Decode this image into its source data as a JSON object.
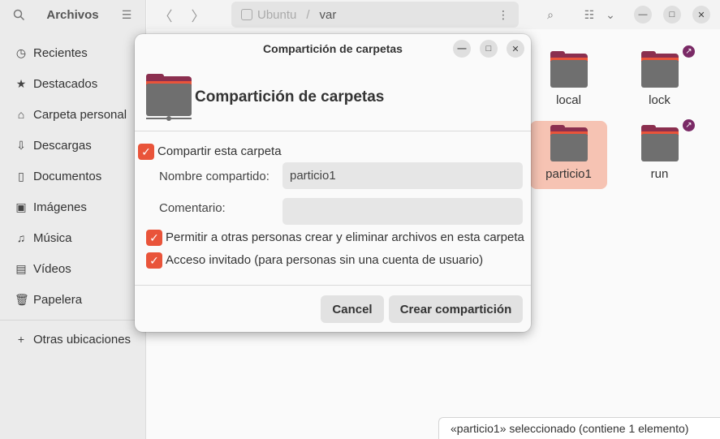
{
  "sidebar": {
    "title": "Archivos",
    "items": [
      {
        "label": "Recientes",
        "icon": "clock-icon"
      },
      {
        "label": "Destacados",
        "icon": "star-icon"
      },
      {
        "label": "Carpeta personal",
        "icon": "home-icon"
      },
      {
        "label": "Descargas",
        "icon": "download-icon"
      },
      {
        "label": "Documentos",
        "icon": "document-icon"
      },
      {
        "label": "Imágenes",
        "icon": "image-icon"
      },
      {
        "label": "Música",
        "icon": "music-icon"
      },
      {
        "label": "Vídeos",
        "icon": "video-icon"
      },
      {
        "label": "Papelera",
        "icon": "trash-icon"
      }
    ],
    "other_locations": "Otras ubicaciones"
  },
  "path": {
    "drive": "Ubuntu",
    "folder": "var"
  },
  "files": [
    {
      "name": "local",
      "selected": false,
      "link": false
    },
    {
      "name": "lock",
      "selected": false,
      "link": true
    },
    {
      "name": "particio1",
      "selected": true,
      "link": false
    },
    {
      "name": "run",
      "selected": false,
      "link": true
    }
  ],
  "status": "«particio1» seleccionado  (contiene 1 elemento)",
  "dialog": {
    "window_title": "Compartición de carpetas",
    "header_title": "Compartición de carpetas",
    "share_checkbox": "Compartir esta carpeta",
    "share_name_label": "Nombre compartido:",
    "share_name_value": "particio1",
    "comment_label": "Comentario:",
    "comment_value": "",
    "allow_others": "Permitir a otras personas crear y eliminar archivos en esta carpeta",
    "guest_access": "Acceso invitado (para personas sin una cuenta de usuario)",
    "cancel": "Cancel",
    "create": "Crear compartición"
  },
  "colors": {
    "accent": "#e9543a",
    "selection": "#f6c3b3",
    "folder_back": "#8b2f4f",
    "folder_front": "#6f6f6f",
    "symlink_badge": "#7a2a66"
  }
}
